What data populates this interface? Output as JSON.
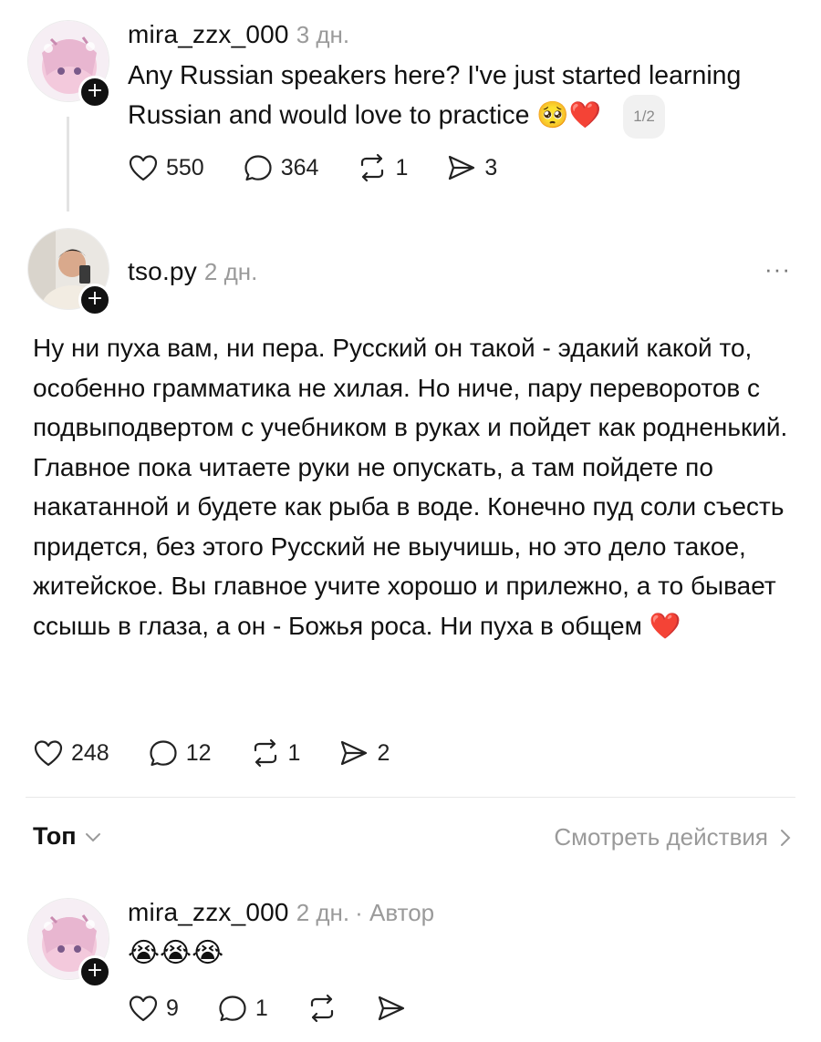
{
  "post1": {
    "username": "mira_zzx_000",
    "time": "3 дн.",
    "text": "Any Russian speakers here? I've just started learning Russian and would love to practice",
    "emoji": "🥺❤️",
    "counter": "1/2",
    "likes": "550",
    "replies": "364",
    "reposts": "1",
    "shares": "3"
  },
  "post2": {
    "username": "tso.py",
    "time": "2 дн.",
    "more": "···",
    "text": "Ну ни пуха вам, ни пера. Русский он такой - эдакий какой то, особенно грамматика не хилая. Но ниче, пару переворотов с подвыподвертом с учебником в руках и пойдет как родненький. Главное пока читаете руки не опускать, а там пойдете по накатанной и будете как рыба в воде. Конечно пуд соли съесть придется, без этого Русский не выучишь, но это дело такое, житейское. Вы главное учите хорошо и прилежно, а то бывает ссышь в глаза, а он - Божья роса. Ни пуха в общем",
    "emoji": "❤️",
    "likes": "248",
    "replies": "12",
    "reposts": "1",
    "shares": "2"
  },
  "sort_bar": {
    "label": "Топ",
    "activity_link": "Смотреть действия"
  },
  "post3": {
    "username": "mira_zzx_000",
    "time": "2 дн.",
    "author_badge": "· Автор",
    "text": "😭😭😭",
    "likes": "9",
    "replies": "1"
  },
  "colors": {
    "heart": "#d7212e",
    "muted": "#9a9a9a",
    "text": "#111111"
  },
  "icons": [
    "plus-icon",
    "heart-icon",
    "comment-icon",
    "repost-icon",
    "share-icon",
    "more-icon",
    "chevron-down-icon",
    "chevron-right-icon"
  ]
}
